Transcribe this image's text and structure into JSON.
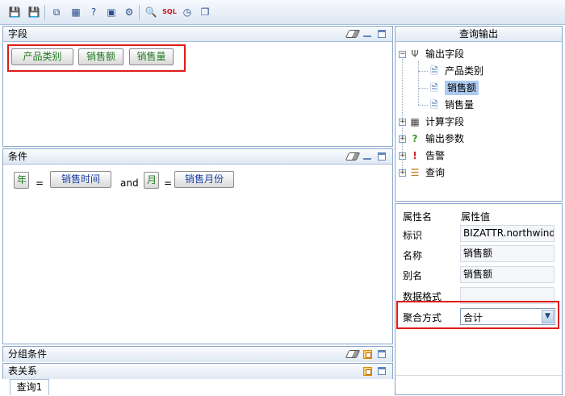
{
  "toolbar": {
    "buttons": [
      {
        "name": "save-icon",
        "glyph": "💾"
      },
      {
        "name": "save-as-icon",
        "glyph": "💾"
      },
      {
        "name": "new-window-icon",
        "glyph": "⧉"
      },
      {
        "name": "table-icon",
        "glyph": "▦"
      },
      {
        "name": "help-icon",
        "glyph": "?"
      },
      {
        "name": "chart-icon",
        "glyph": "▣"
      },
      {
        "name": "settings-icon",
        "glyph": "⚙"
      },
      {
        "name": "search-icon",
        "glyph": "🔍"
      },
      {
        "name": "sql-icon",
        "glyph": "SQL"
      },
      {
        "name": "clock-icon",
        "glyph": "◷"
      },
      {
        "name": "export-icon",
        "glyph": "❐"
      }
    ]
  },
  "fields_panel": {
    "title": "字段",
    "chips": [
      "产品类别",
      "销售额",
      "销售量"
    ]
  },
  "conditions_panel": {
    "title": "条件",
    "year_func": "年",
    "eq1": "=",
    "sales_time": "销售时间",
    "and": "and",
    "month_func": "月",
    "eq2": "=",
    "sales_month": "销售月份"
  },
  "group_panel": {
    "title": "分组条件"
  },
  "relations_panel": {
    "title": "表关系"
  },
  "tabs": {
    "query1": "查询1"
  },
  "output_panel": {
    "title": "查询输出",
    "tree": {
      "output_fields": "输出字段",
      "children": [
        "产品类别",
        "销售额",
        "销售量"
      ],
      "computed_fields": "计算字段",
      "output_params": "输出参数",
      "alerts": "告警",
      "query": "查询"
    }
  },
  "properties": {
    "header_name": "属性名",
    "header_value": "属性值",
    "rows": [
      {
        "label": "标识",
        "value": "BIZATTR.northwind."
      },
      {
        "label": "名称",
        "value": "销售额"
      },
      {
        "label": "别名",
        "value": "销售额"
      },
      {
        "label": "数据格式",
        "value": ""
      }
    ],
    "aggregation_label": "聚合方式",
    "aggregation_value": "合计"
  }
}
